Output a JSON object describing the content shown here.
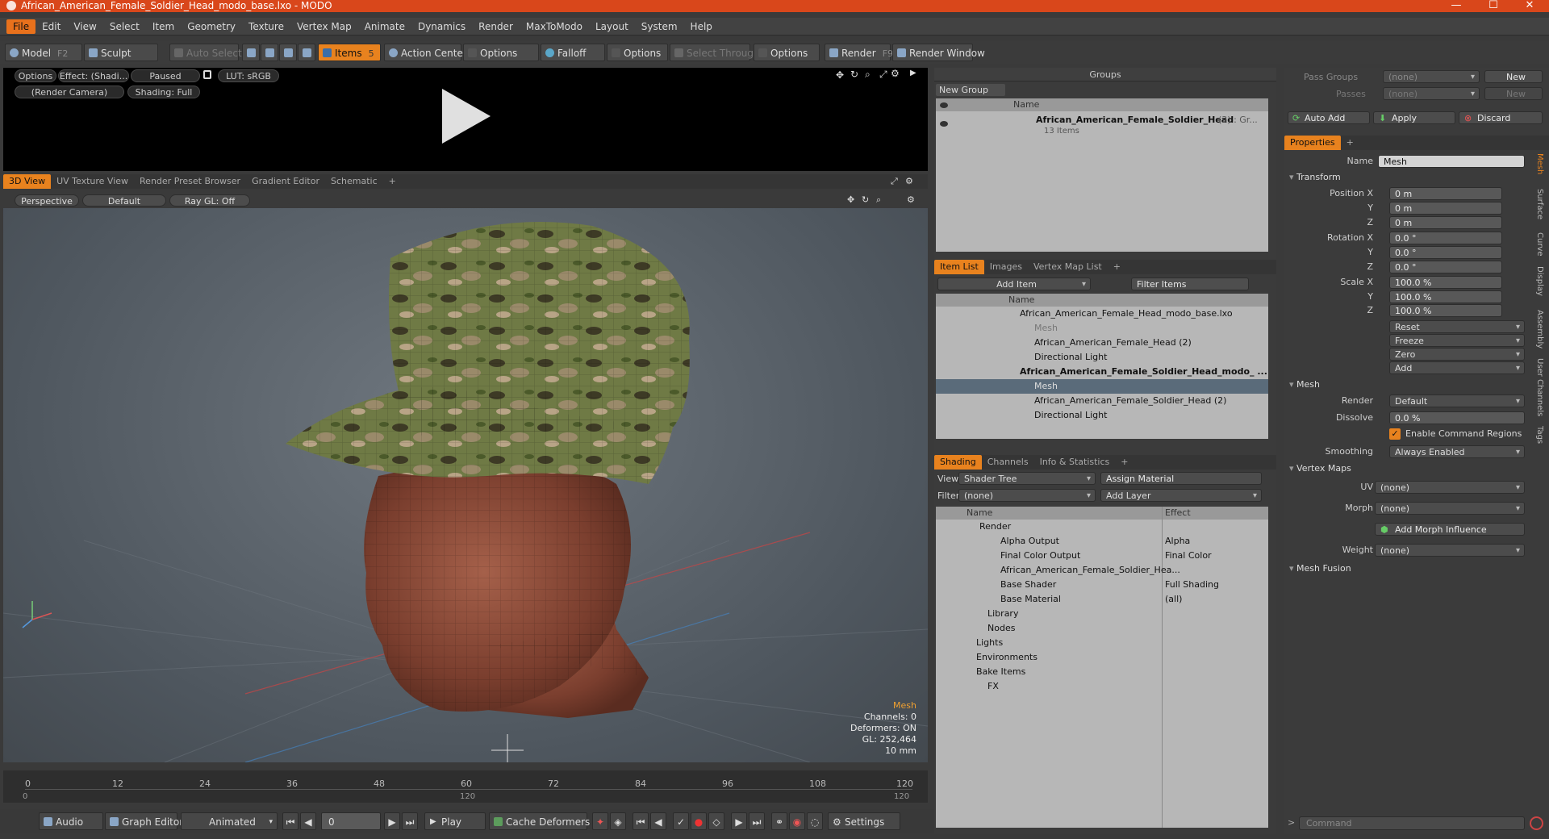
{
  "window": {
    "title": "African_American_Female_Soldier_Head_modo_base.lxo - MODO",
    "minimize": "—",
    "maximize": "☐",
    "close": "✕"
  },
  "menu": [
    "File",
    "Edit",
    "View",
    "Select",
    "Item",
    "Geometry",
    "Texture",
    "Vertex Map",
    "Animate",
    "Dynamics",
    "Render",
    "MaxToModo",
    "Layout",
    "System",
    "Help"
  ],
  "toolbar": {
    "model": "Model",
    "model_key": "F2",
    "sculpt": "Sculpt",
    "auto_select": "Auto Select",
    "items": "Items",
    "items_key": "5",
    "action_center": "Action Center",
    "options1": "Options",
    "falloff": "Falloff",
    "options2": "Options",
    "select_through": "Select Through",
    "options3": "Options",
    "render": "Render",
    "render_key": "F9",
    "render_window": "Render Window"
  },
  "preview": {
    "options": "Options",
    "effect": "Effect: (Shadi...",
    "paused": "Paused",
    "lut": "LUT: sRGB",
    "camera": "(Render Camera)",
    "shading": "Shading: Full"
  },
  "view_tabs": [
    "3D View",
    "UV Texture View",
    "Render Preset Browser",
    "Gradient Editor",
    "Schematic",
    "+"
  ],
  "viewport": {
    "perspective": "Perspective",
    "default": "Default",
    "raygl": "Ray GL: Off",
    "info_title": "Mesh",
    "info_channels": "Channels: 0",
    "info_deformers": "Deformers: ON",
    "info_gl": "GL: 252,464",
    "info_size": "10 mm"
  },
  "timeline": {
    "ticks": [
      "0",
      "12",
      "24",
      "36",
      "48",
      "60",
      "72",
      "84",
      "96",
      "108",
      "120"
    ],
    "start": "0",
    "mid": "120",
    "end": "120"
  },
  "bottom": {
    "audio": "Audio",
    "graph_editor": "Graph Editor",
    "animated": "Animated",
    "frame": "0",
    "play": "Play",
    "cache": "Cache Deformers",
    "settings": "Settings"
  },
  "groups": {
    "title": "Groups",
    "new_group": "New Group",
    "col_name": "Name",
    "item": "African_American_Female_Soldier_Head",
    "item_suffix": "(3) : Gr...",
    "item_count": "13 Items"
  },
  "itemlist": {
    "tabs": [
      "Item List",
      "Images",
      "Vertex Map List",
      "+"
    ],
    "add_item": "Add Item",
    "filter": "Filter Items",
    "col_name": "Name",
    "rows": [
      {
        "label": "African_American_Female_Head_modo_base.lxo",
        "indent": 0
      },
      {
        "label": "Mesh",
        "indent": 2
      },
      {
        "label": "African_American_Female_Head (2)",
        "indent": 2
      },
      {
        "label": "Directional Light",
        "indent": 2
      },
      {
        "label": "African_American_Female_Soldier_Head_modo_ ...",
        "indent": 0
      },
      {
        "label": "Mesh",
        "indent": 2
      },
      {
        "label": "African_American_Female_Soldier_Head (2)",
        "indent": 2
      },
      {
        "label": "Directional Light",
        "indent": 2
      }
    ]
  },
  "shading": {
    "tabs": [
      "Shading",
      "Channels",
      "Info & Statistics",
      "+"
    ],
    "view_label": "View",
    "view_value": "Shader Tree",
    "assign": "Assign Material",
    "filter_label": "Filter",
    "filter_value": "(none)",
    "add_layer": "Add Layer",
    "col_name": "Name",
    "col_effect": "Effect",
    "rows": [
      {
        "name": "Render",
        "effect": ""
      },
      {
        "name": "Alpha Output",
        "effect": "Alpha"
      },
      {
        "name": "Final Color Output",
        "effect": "Final Color"
      },
      {
        "name": "African_American_Female_Soldier_Hea...",
        "effect": ""
      },
      {
        "name": "Base Shader",
        "effect": "Full Shading"
      },
      {
        "name": "Base Material",
        "effect": "(all)"
      },
      {
        "name": "Library",
        "effect": ""
      },
      {
        "name": "Nodes",
        "effect": ""
      },
      {
        "name": "Lights",
        "effect": ""
      },
      {
        "name": "Environments",
        "effect": ""
      },
      {
        "name": "Bake Items",
        "effect": ""
      },
      {
        "name": "FX",
        "effect": ""
      }
    ]
  },
  "props": {
    "pass_groups": "Pass Groups",
    "passes": "Passes",
    "none": "(none)",
    "new": "New",
    "auto_add": "Auto Add",
    "apply": "Apply",
    "discard": "Discard",
    "tab": "Properties",
    "name_label": "Name",
    "name_value": "Mesh",
    "transform": "Transform",
    "pos_label": "Position X",
    "pos": [
      "0 m",
      "0 m",
      "0 m"
    ],
    "rot_label": "Rotation X",
    "rot": [
      "0.0 °",
      "0.0 °",
      "0.0 °"
    ],
    "scale_label": "Scale X",
    "scale": [
      "100.0 %",
      "100.0 %",
      "100.0 %"
    ],
    "y": "Y",
    "z": "Z",
    "reset": "Reset",
    "freeze": "Freeze",
    "zero": "Zero",
    "add": "Add",
    "mesh": "Mesh",
    "render_label": "Render",
    "render_value": "Default",
    "dissolve_label": "Dissolve",
    "dissolve_value": "0.0 %",
    "cmd_regions": "Enable Command Regions",
    "smoothing_label": "Smoothing",
    "smoothing_value": "Always Enabled",
    "vertex_maps": "Vertex Maps",
    "uv_label": "UV",
    "morph_label": "Morph",
    "add_morph": "Add Morph Influence",
    "weight_label": "Weight",
    "mesh_fusion": "Mesh Fusion",
    "side_tabs": [
      "Mesh",
      "Surface",
      "Curve",
      "Display",
      "Assembly",
      "User Channels",
      "Tags"
    ],
    "command": "Command"
  },
  "colors": {
    "accent": "#e8821e",
    "titlebar": "#d9471b"
  }
}
